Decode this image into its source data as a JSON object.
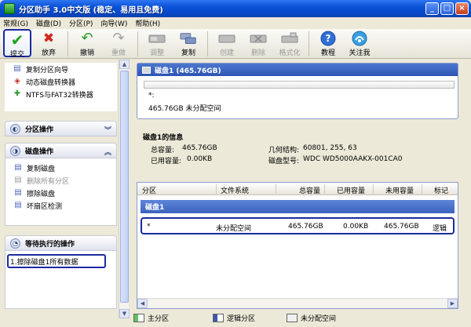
{
  "window": {
    "title": "分区助手 3.0中文版 (稳定、易用且免费)",
    "buttons": {
      "minimize": "_",
      "maximize": "□",
      "close": "×"
    }
  },
  "menu": [
    "常规(G)",
    "磁盘(D)",
    "分区(P)",
    "向导(W)",
    "帮助(H)"
  ],
  "toolbar": [
    {
      "label": "提交",
      "icon": "check-icon",
      "state": "active"
    },
    {
      "label": "放弃",
      "icon": "discard-icon",
      "state": "enabled"
    },
    {
      "label": "撤销",
      "icon": "undo-icon",
      "state": "enabled"
    },
    {
      "label": "重做",
      "icon": "redo-icon",
      "state": "disabled"
    },
    {
      "label": "调整",
      "icon": "resize-icon",
      "state": "disabled"
    },
    {
      "label": "复制",
      "icon": "copy-icon",
      "state": "enabled"
    },
    {
      "label": "创建",
      "icon": "create-icon",
      "state": "disabled"
    },
    {
      "label": "删除",
      "icon": "delete-icon",
      "state": "disabled"
    },
    {
      "label": "格式化",
      "icon": "format-icon",
      "state": "disabled"
    },
    {
      "label": "教程",
      "icon": "help-icon",
      "state": "enabled"
    },
    {
      "label": "关注我",
      "icon": "follow-icon",
      "state": "enabled"
    }
  ],
  "sidebar": {
    "wizard_items": [
      "复制分区向导",
      "动态磁盘转换器",
      "NTFS与FAT32转换器"
    ],
    "partition_ops_title": "分区操作",
    "disk_ops_title": "磁盘操作",
    "disk_ops_items": [
      {
        "label": "复制磁盘",
        "disabled": false
      },
      {
        "label": "删除所有分区",
        "disabled": true
      },
      {
        "label": "擦除磁盘",
        "disabled": false
      },
      {
        "label": "坏扇区检测",
        "disabled": false
      }
    ],
    "pending_title": "等待执行的操作",
    "pending_items": [
      "1.擦除磁盘1所有数据"
    ]
  },
  "disk_card": {
    "title": "磁盘1 (465.76GB)",
    "partition_letter": "*:",
    "partition_desc": "465.76GB 未分配空间"
  },
  "disk_info": {
    "title": "磁盘1的信息",
    "total_label": "总容量:",
    "total_value": "465.76GB",
    "used_label": "已用容量:",
    "used_value": "0.00KB",
    "geometry_label": "几何结构:",
    "geometry_value": "60801, 255, 63",
    "model_label": "磁盘型号:",
    "model_value": "WDC WD5000AAKX-001CA0"
  },
  "table": {
    "columns": [
      "分区",
      "文件系统",
      "总容量",
      "已用容量",
      "未用容量",
      "标记"
    ],
    "disk_row": "磁盘1",
    "row": [
      "*",
      "未分配空间",
      "465.76GB",
      "0.00KB",
      "465.76GB",
      "逻辑"
    ]
  },
  "legend": [
    "主分区",
    "逻辑分区",
    "未分配空间"
  ]
}
